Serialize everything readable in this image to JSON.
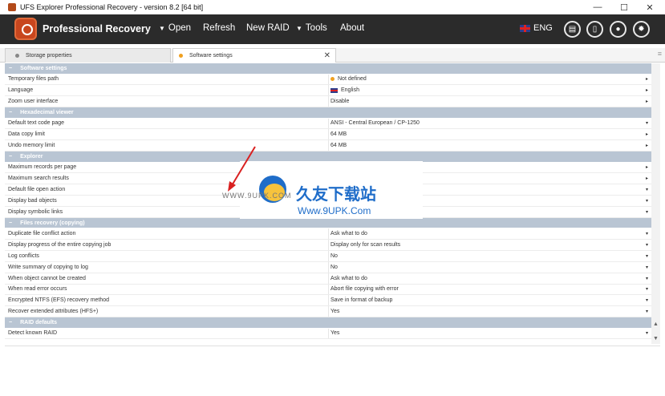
{
  "window": {
    "title": "UFS Explorer Professional Recovery - version 8.2 [64 bit]",
    "minimize": "—",
    "maximize": "☐",
    "close": "✕"
  },
  "toolbar": {
    "brand": "Professional Recovery",
    "menu": [
      {
        "label": "Open",
        "has_dropdown": true
      },
      {
        "label": "Refresh",
        "has_dropdown": false
      },
      {
        "label": "New RAID",
        "has_dropdown": false
      },
      {
        "label": "Tools",
        "has_dropdown": true
      },
      {
        "label": "About",
        "has_dropdown": false
      }
    ],
    "language": "ENG",
    "icons": [
      "drive-icon",
      "panels-icon",
      "user-icon",
      "gear-icon"
    ]
  },
  "tabs": [
    {
      "label": "Storage properties",
      "dot_color": "#888888"
    },
    {
      "label": "Software settings",
      "dot_color": "#f0a020",
      "close": "✕"
    }
  ],
  "sections": [
    {
      "title": "Software settings",
      "rows": [
        {
          "key": "Temporary files path",
          "value": "Not defined",
          "marker": "orange-dot",
          "control": "▸"
        },
        {
          "key": "Language",
          "value": "English",
          "marker": "uk-flag",
          "control": "▸"
        },
        {
          "key": "Zoom user interface",
          "value": "Disable",
          "control": "▸"
        }
      ]
    },
    {
      "title": "Hexadecimal viewer",
      "rows": [
        {
          "key": "Default text code page",
          "value": "ANSI - Central European / CP-1250",
          "control": "▾"
        },
        {
          "key": "Data copy limit",
          "value": "64 MB",
          "control": "▸"
        },
        {
          "key": "Undo memory limit",
          "value": "64 MB",
          "control": "▸"
        }
      ]
    },
    {
      "title": "Explorer",
      "rows": [
        {
          "key": "Maximum records per page",
          "value": "",
          "control": "▸"
        },
        {
          "key": "Maximum search results",
          "value": "",
          "control": "▸"
        },
        {
          "key": "Default file open action",
          "value": "",
          "control": "▾"
        },
        {
          "key": "Display bad objects",
          "value": "",
          "control": "▾"
        },
        {
          "key": "Display symbolic links",
          "value": "",
          "control": "▾"
        }
      ]
    },
    {
      "title": "Files recovery (copying)",
      "rows": [
        {
          "key": "Duplicate file conflict action",
          "value": "Ask what to do",
          "control": "▾"
        },
        {
          "key": "Display progress of the entire copying job",
          "value": "Display only for scan results",
          "control": "▾"
        },
        {
          "key": "Log conflicts",
          "value": "No",
          "control": "▾"
        },
        {
          "key": "Write summary of copying to log",
          "value": "No",
          "control": "▾"
        },
        {
          "key": "When object cannot be created",
          "value": "Ask what to do",
          "control": "▾"
        },
        {
          "key": "When read error occurs",
          "value": "Abort file copying with error",
          "control": "▾"
        },
        {
          "key": "Encrypted NTFS (EFS) recovery method",
          "value": "Save in format of backup",
          "control": "▾"
        },
        {
          "key": "Recover extended attributes (HFS+)",
          "value": "Yes",
          "control": "▾"
        }
      ]
    },
    {
      "title": "RAID defaults",
      "rows": [
        {
          "key": "Detect known RAID",
          "value": "Yes",
          "control": "▾"
        }
      ]
    }
  ],
  "watermark": {
    "chinese": "久友下载站",
    "url": "Www.9UPK.Com",
    "side": "WWW.9UPK.COM"
  },
  "colors": {
    "toolbar_bg": "#2b2b2b",
    "section_bg": "#b9c5d3",
    "accent_orange": "#f0a020",
    "brand_orange": "#c8461e"
  }
}
